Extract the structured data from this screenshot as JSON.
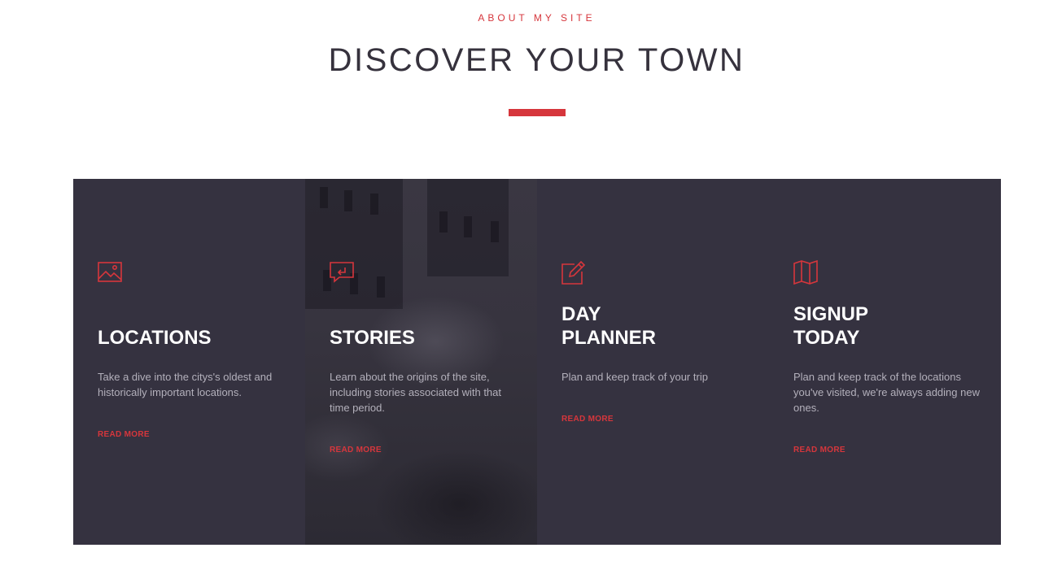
{
  "header": {
    "eyebrow": "ABOUT MY SITE",
    "title": "DISCOVER YOUR TOWN"
  },
  "colors": {
    "accent": "#d6363c",
    "card_background": "#353240",
    "title_text": "#36323d"
  },
  "cards": [
    {
      "icon": "image-icon",
      "title_lines": [
        "LOCATIONS"
      ],
      "text": "Take a dive into the citys's oldest and historically important locations.",
      "link": "READ MORE"
    },
    {
      "icon": "message-reply-icon",
      "title_lines": [
        "STORIES"
      ],
      "text": "Learn about the origins of the site, including stories associated with that time period.",
      "link": "READ MORE"
    },
    {
      "icon": "edit-icon",
      "title_lines": [
        "DAY",
        "PLANNER"
      ],
      "text": "Plan and keep track of your trip",
      "link": "READ MORE"
    },
    {
      "icon": "map-icon",
      "title_lines": [
        "SIGNUP",
        "TODAY"
      ],
      "text": "Plan and keep track of the locations you've visited, we're always adding new ones.",
      "link": "READ MORE"
    }
  ]
}
